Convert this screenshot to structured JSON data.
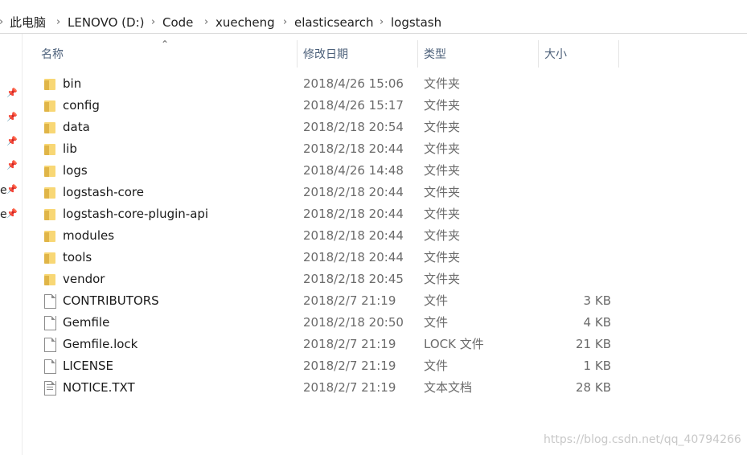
{
  "breadcrumb": [
    "此电脑",
    "LENOVO (D:)",
    "Code",
    "xuecheng",
    "elasticsearch",
    "logstash"
  ],
  "columns": {
    "name": "名称",
    "date": "修改日期",
    "type": "类型",
    "size": "大小"
  },
  "nav_fragments": [
    "e",
    "e"
  ],
  "files": [
    {
      "name": "bin",
      "date": "2018/4/26 15:06",
      "type": "文件夹",
      "size": "",
      "icon": "folder-icon"
    },
    {
      "name": "config",
      "date": "2018/4/26 15:17",
      "type": "文件夹",
      "size": "",
      "icon": "folder-icon"
    },
    {
      "name": "data",
      "date": "2018/2/18 20:54",
      "type": "文件夹",
      "size": "",
      "icon": "folder-icon"
    },
    {
      "name": "lib",
      "date": "2018/2/18 20:44",
      "type": "文件夹",
      "size": "",
      "icon": "folder-icon"
    },
    {
      "name": "logs",
      "date": "2018/4/26 14:48",
      "type": "文件夹",
      "size": "",
      "icon": "folder-icon"
    },
    {
      "name": "logstash-core",
      "date": "2018/2/18 20:44",
      "type": "文件夹",
      "size": "",
      "icon": "folder-icon"
    },
    {
      "name": "logstash-core-plugin-api",
      "date": "2018/2/18 20:44",
      "type": "文件夹",
      "size": "",
      "icon": "folder-icon"
    },
    {
      "name": "modules",
      "date": "2018/2/18 20:44",
      "type": "文件夹",
      "size": "",
      "icon": "folder-icon"
    },
    {
      "name": "tools",
      "date": "2018/2/18 20:44",
      "type": "文件夹",
      "size": "",
      "icon": "folder-icon"
    },
    {
      "name": "vendor",
      "date": "2018/2/18 20:45",
      "type": "文件夹",
      "size": "",
      "icon": "folder-icon"
    },
    {
      "name": "CONTRIBUTORS",
      "date": "2018/2/7 21:19",
      "type": "文件",
      "size": "3 KB",
      "icon": "file-icon"
    },
    {
      "name": "Gemfile",
      "date": "2018/2/18 20:50",
      "type": "文件",
      "size": "4 KB",
      "icon": "file-icon"
    },
    {
      "name": "Gemfile.lock",
      "date": "2018/2/7 21:19",
      "type": "LOCK 文件",
      "size": "21 KB",
      "icon": "file-icon"
    },
    {
      "name": "LICENSE",
      "date": "2018/2/7 21:19",
      "type": "文件",
      "size": "1 KB",
      "icon": "file-icon"
    },
    {
      "name": "NOTICE.TXT",
      "date": "2018/2/7 21:19",
      "type": "文本文档",
      "size": "28 KB",
      "icon": "text-file-icon"
    }
  ],
  "watermark": "https://blog.csdn.net/qq_40794266"
}
